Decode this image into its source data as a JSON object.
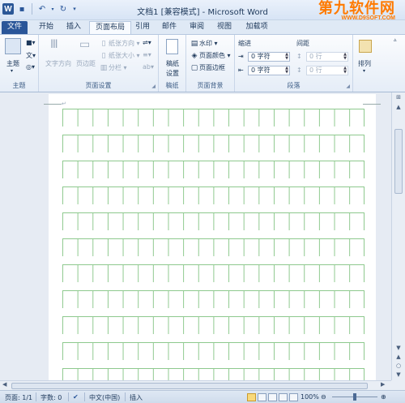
{
  "window": {
    "title": "文档1 [兼容模式] - Microsoft Word",
    "app_icon": "W",
    "quick_access": [
      "save-icon",
      "undo-icon",
      "redo-icon",
      "customize-icon"
    ]
  },
  "watermark": {
    "big": "第九软件网",
    "small": "WWW.D9SOFT.COM"
  },
  "tabs": [
    "文件",
    "开始",
    "插入",
    "页面布局",
    "引用",
    "邮件",
    "审阅",
    "视图",
    "加载项"
  ],
  "active_tab": "页面布局",
  "ribbon": {
    "themes": {
      "label": "主题",
      "btn": "主题"
    },
    "page_setup": {
      "label": "页面设置",
      "text_direction": "文字方向",
      "margins": "页边距",
      "orientation": "纸张方向",
      "size": "纸张大小",
      "columns": "分栏"
    },
    "manuscript": {
      "label": "稿纸",
      "btn_line1": "稿纸",
      "btn_line2": "设置"
    },
    "background": {
      "label": "页面背景",
      "watermark": "水印",
      "page_color": "页面颜色",
      "page_borders": "页面边框"
    },
    "paragraph": {
      "label": "段落",
      "indent_header": "缩进",
      "spacing_header": "间距",
      "indent_left": "0 字符",
      "indent_right": "0 字符",
      "spacing_before": "0 行",
      "spacing_after": "0 行"
    },
    "arrange": {
      "label": "排列"
    }
  },
  "page": {
    "pilcrow": "↵"
  },
  "status": {
    "page": "页面: 1/1",
    "words": "字数: 0",
    "language": "中文(中国)",
    "mode": "插入",
    "zoom": "100%",
    "zoom_level_percent": 100
  }
}
